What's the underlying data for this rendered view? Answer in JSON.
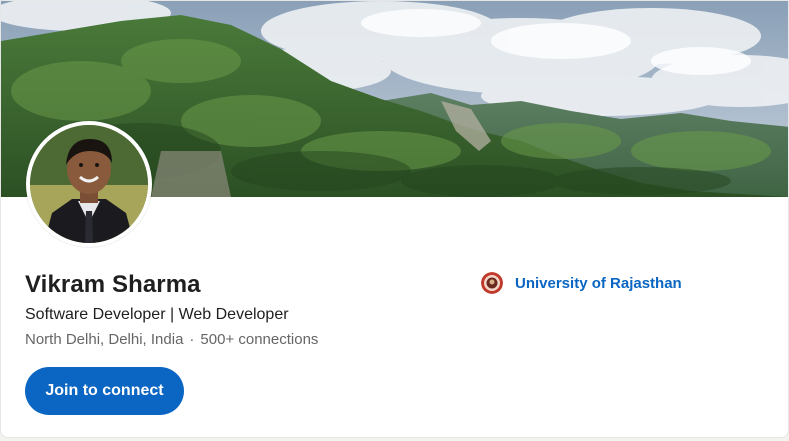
{
  "profile": {
    "name": "Vikram Sharma",
    "headline": "Software Developer | Web Developer",
    "location": "North Delhi, Delhi, India",
    "separator": "·",
    "connections": "500+ connections"
  },
  "actions": {
    "join_label": "Join to connect"
  },
  "education": {
    "school_name": "University of Rajasthan"
  },
  "colors": {
    "brand_blue": "#0a66c2",
    "text_primary": "#1f1f1f",
    "text_secondary": "#666666"
  },
  "icons": {
    "cover": "mountain-landscape-image",
    "avatar": "profile-photo",
    "school_logo": "university-seal-icon"
  }
}
